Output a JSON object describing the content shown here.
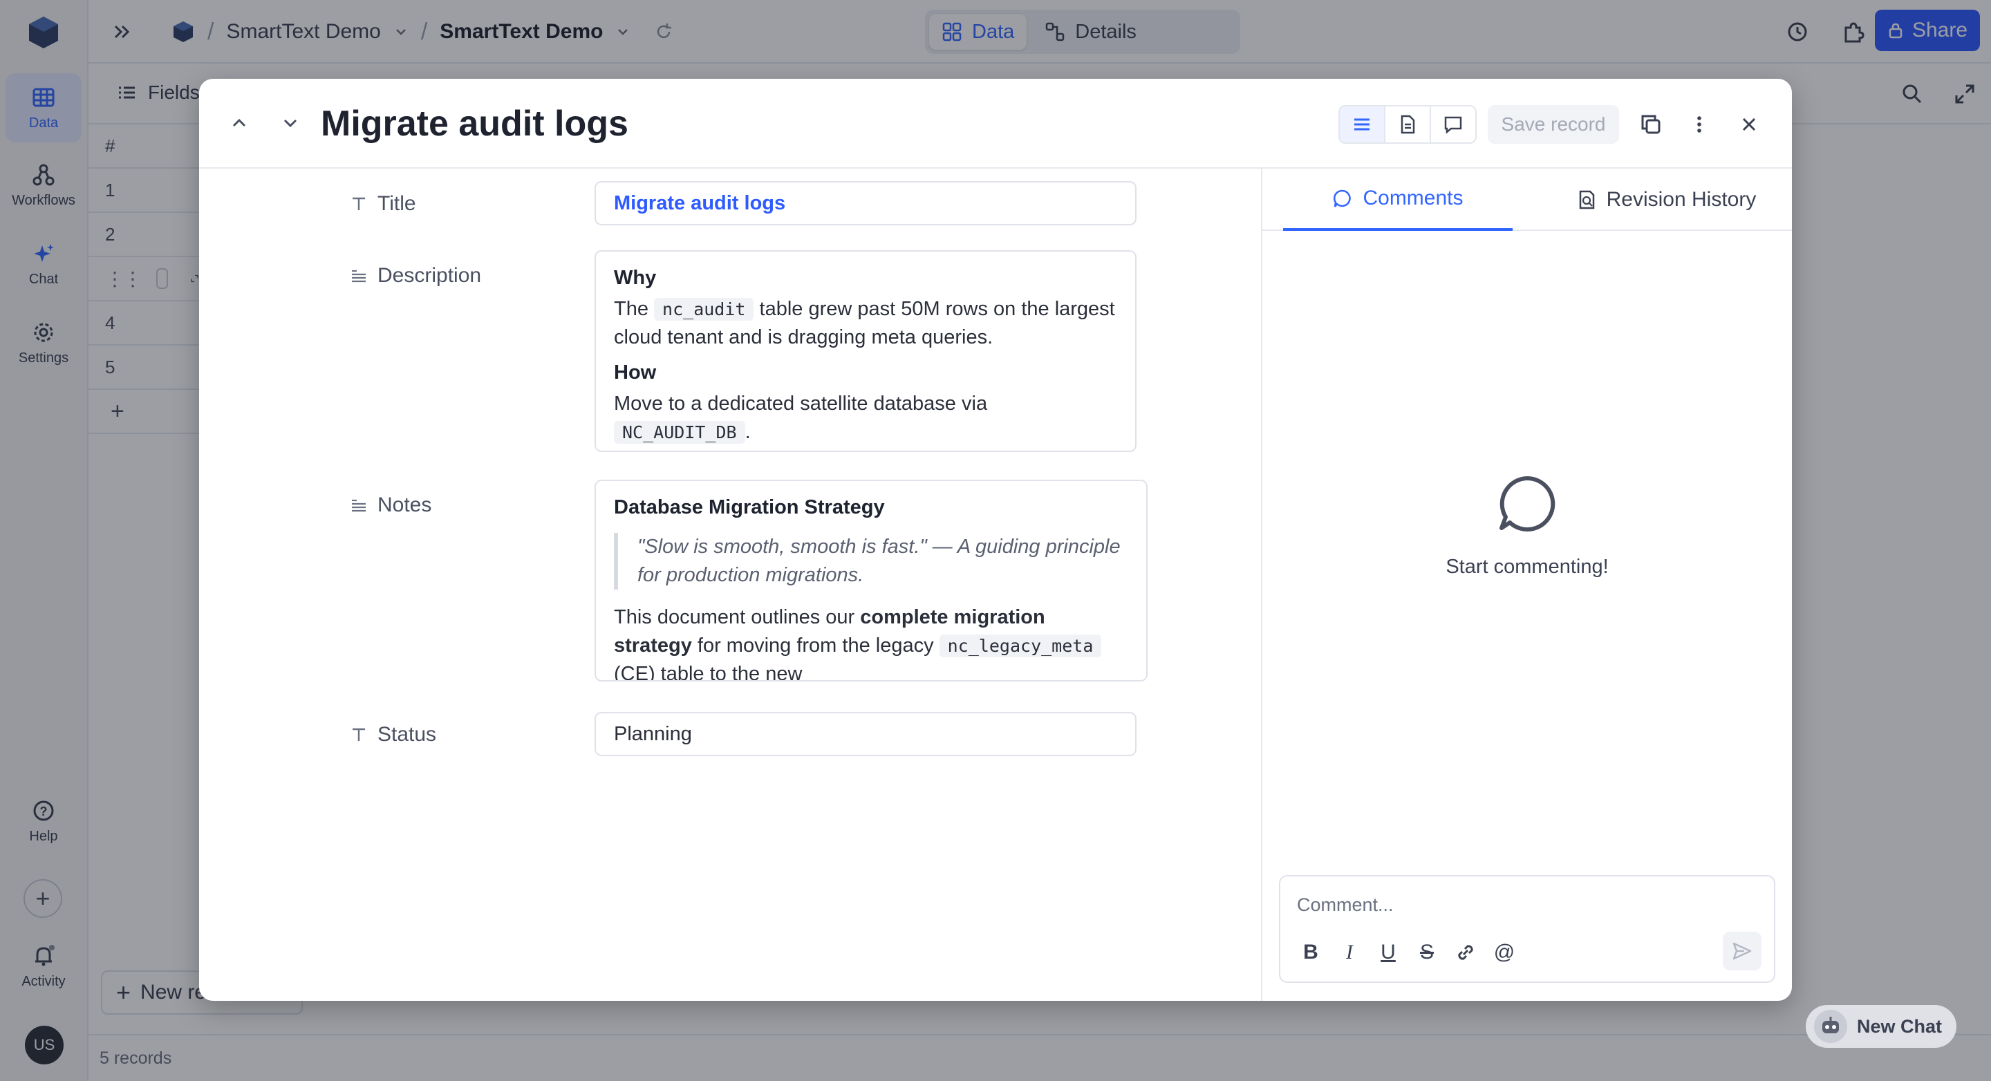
{
  "rail": {
    "items": [
      {
        "label": "Data",
        "icon": "grid-icon"
      },
      {
        "label": "Workflows",
        "icon": "workflow-icon"
      },
      {
        "label": "Chat",
        "icon": "sparkle-icon"
      },
      {
        "label": "Settings",
        "icon": "gear-icon"
      }
    ],
    "help_label": "Help",
    "activity_label": "Activity",
    "avatar_initials": "US"
  },
  "topbar": {
    "crumb_1": "SmartText Demo",
    "crumb_2": "SmartText Demo",
    "view_data": "Data",
    "view_details": "Details",
    "share_label": "Share"
  },
  "grid": {
    "fields_label": "Fields",
    "header": "#",
    "rows": [
      "1",
      "2",
      "",
      "4",
      "5"
    ],
    "new_record_label": "New re",
    "record_count": "5 records"
  },
  "record": {
    "title": "Migrate audit logs",
    "save_label": "Save record",
    "fields": {
      "title_label": "Title",
      "title_value": "Migrate audit logs",
      "description_label": "Description",
      "description": {
        "h1": "Why",
        "p1_a": "The",
        "p1_code": "nc_audit",
        "p1_b": "table grew past 50M rows on the largest cloud tenant and is dragging meta queries.",
        "h2": "How",
        "p2_a": "Move to a dedicated satellite database via",
        "p2_code": "NC_AUDIT_DB",
        "p2_b": "."
      },
      "notes_label": "Notes",
      "notes": {
        "heading": "Database Migration Strategy",
        "quote": "\"Slow is smooth, smooth is fast.\" — A guiding principle for production migrations.",
        "p_a": "This document outlines our",
        "p_bold": "complete migration strategy",
        "p_b": "for moving from the legacy",
        "p_code": "nc_legacy_meta",
        "p_c": "(CE) table to the new"
      },
      "status_label": "Status",
      "status_value": "Planning"
    }
  },
  "side": {
    "tab_comments": "Comments",
    "tab_history": "Revision History",
    "empty_text": "Start commenting!",
    "comment_placeholder": "Comment..."
  },
  "chat_button": "New Chat",
  "colors": {
    "accent": "#3366ff",
    "share": "#2d5bff"
  }
}
